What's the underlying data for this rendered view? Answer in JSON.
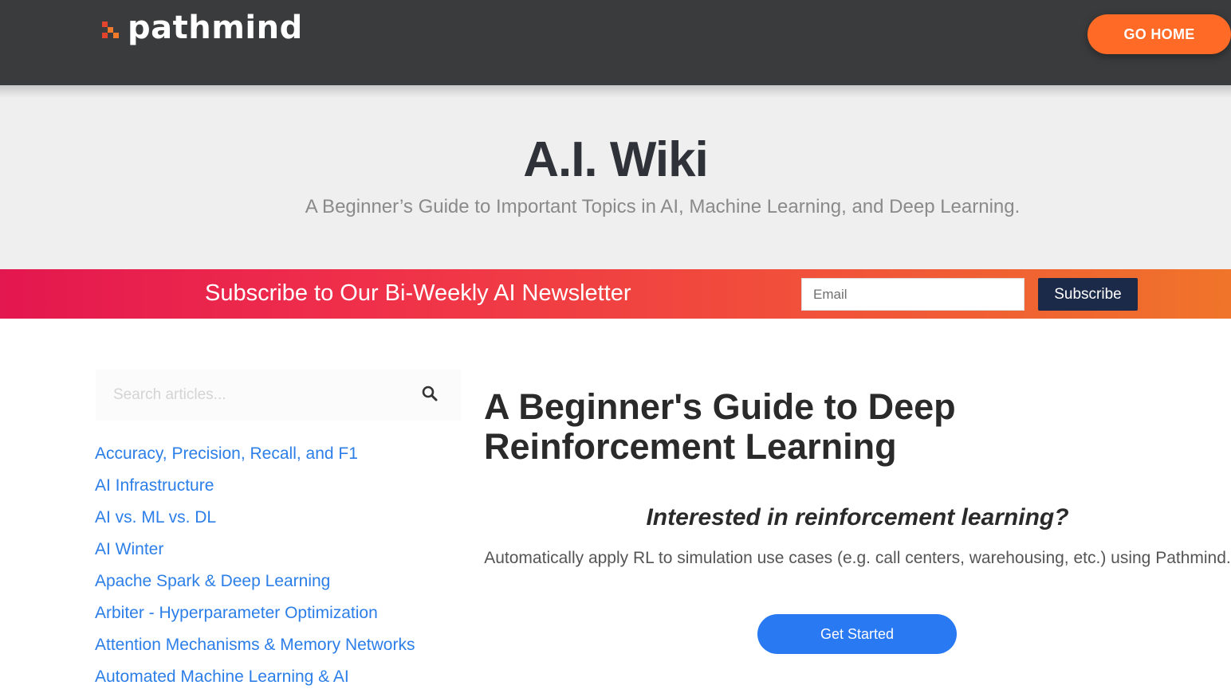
{
  "brand": {
    "name": "pathmind",
    "logo_icon": "pixel-cluster-icon",
    "logo_colors": [
      "#e2432c",
      "#f07a2a"
    ]
  },
  "header": {
    "background": "#3a3b3c",
    "go_home_label": "GO HOME",
    "go_home_color": "#ff6a26"
  },
  "hero": {
    "title": "A.I. Wiki",
    "subtitle": "A Beginner’s Guide to Important Topics in AI, Machine Learning, and Deep Learning."
  },
  "newsletter": {
    "headline": "Subscribe to Our Bi-Weekly AI Newsletter",
    "email_placeholder": "Email",
    "subscribe_label": "Subscribe"
  },
  "sidebar": {
    "search_placeholder": "Search articles...",
    "search_icon": "search-icon",
    "links": [
      "Accuracy, Precision, Recall, and F1",
      "AI Infrastructure",
      "AI vs. ML vs. DL",
      "AI Winter",
      "Apache Spark & Deep Learning",
      "Arbiter - Hyperparameter Optimization",
      "Attention Mechanisms & Memory Networks",
      "Automated Machine Learning & AI"
    ]
  },
  "article": {
    "title": "A Beginner's Guide to Deep Reinforcement Learning",
    "cta_heading": "Interested in reinforcement learning?",
    "cta_body": "Automatically apply RL to simulation use cases (e.g. call centers, warehousing, etc.) using Pathmind.",
    "cta_button_label": "Get Started",
    "cta_button_color": "#2979f2"
  }
}
